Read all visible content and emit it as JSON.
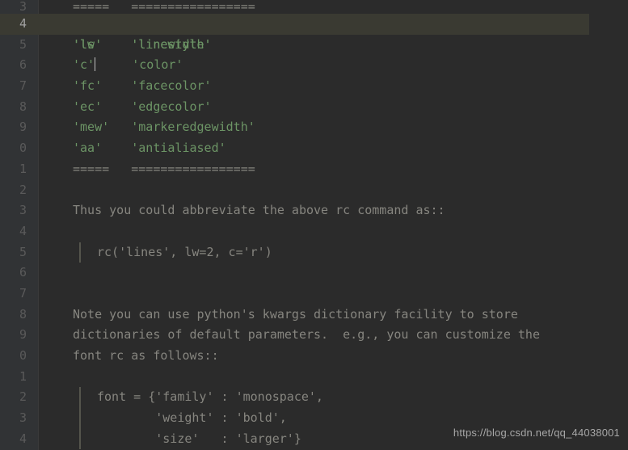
{
  "gutter": {
    "lines": [
      "3",
      "4",
      "5",
      "6",
      "7",
      "8",
      "9",
      "0",
      "1",
      "2",
      "3",
      "4",
      "5",
      "6",
      "7",
      "8",
      "9",
      "0",
      "1",
      "2",
      "3",
      "4"
    ],
    "highlight_index": 1,
    "bulb_index": 1
  },
  "code": {
    "highlight_index": 1,
    "lines": [
      {
        "type": "row",
        "cells": [
          "=====",
          "================="
        ],
        "tok": "txt"
      },
      {
        "type": "row",
        "cells": [
          "'lw'",
          "'linewidth'"
        ],
        "tok": "s",
        "highlight": true
      },
      {
        "type": "row",
        "cells": [
          "'ls'",
          "'linestyle'"
        ],
        "tok": "s"
      },
      {
        "type": "row",
        "cells": [
          "'c'",
          "'color'"
        ],
        "tok": "s",
        "caret_in_first": 3
      },
      {
        "type": "row",
        "cells": [
          "'fc'",
          "'facecolor'"
        ],
        "tok": "s"
      },
      {
        "type": "row",
        "cells": [
          "'ec'",
          "'edgecolor'"
        ],
        "tok": "s"
      },
      {
        "type": "row",
        "cells": [
          "'mew'",
          "'markeredgewidth'"
        ],
        "tok": "s"
      },
      {
        "type": "row",
        "cells": [
          "'aa'",
          "'antialiased'"
        ],
        "tok": "s"
      },
      {
        "type": "row",
        "cells": [
          "=====",
          "================="
        ],
        "tok": "txt"
      },
      {
        "type": "blank"
      },
      {
        "type": "prose",
        "text": "Thus you could abbreviate the above rc command as::"
      },
      {
        "type": "blank"
      },
      {
        "type": "block",
        "text": "rc('lines', lw=2, c='r')"
      },
      {
        "type": "blank"
      },
      {
        "type": "blank"
      },
      {
        "type": "prose",
        "text": "Note you can use python's kwargs dictionary facility to store"
      },
      {
        "type": "prose",
        "text": "dictionaries of default parameters.  e.g., you can customize the"
      },
      {
        "type": "prose",
        "text": "font rc as follows::"
      },
      {
        "type": "blank"
      },
      {
        "type": "block",
        "text": "font = {'family' : 'monospace',"
      },
      {
        "type": "block",
        "text": "        'weight' : 'bold',"
      },
      {
        "type": "block",
        "text": "        'size'   : 'larger'}"
      }
    ]
  },
  "columns": {
    "col1_width": 8
  },
  "watermark": "https://blog.csdn.net/qq_44038001"
}
